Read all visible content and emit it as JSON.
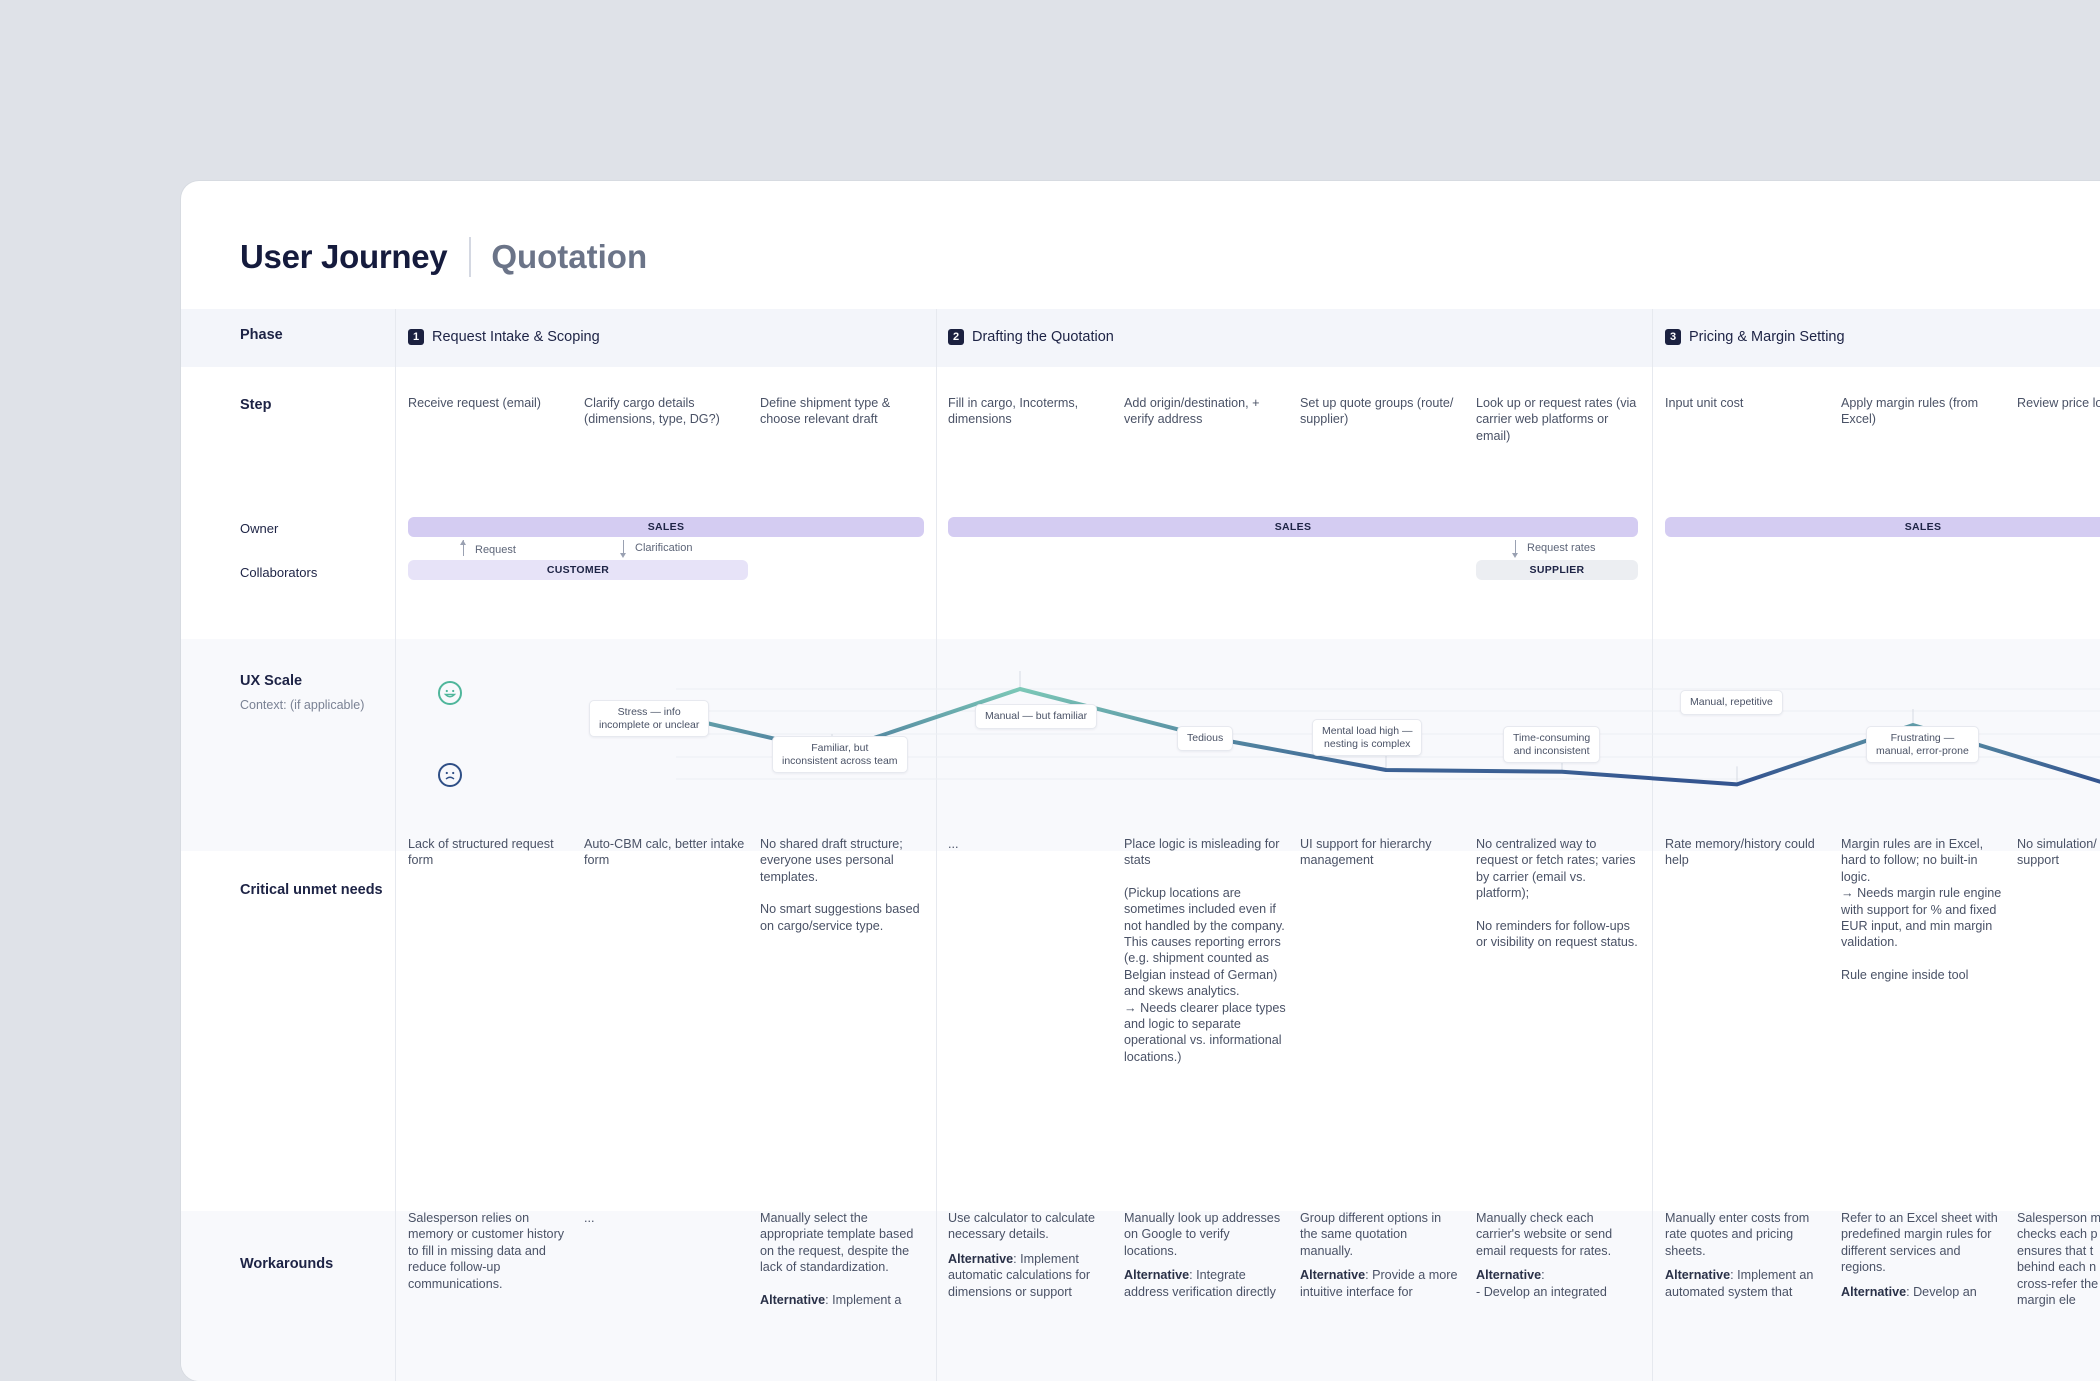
{
  "header": {
    "title": "User Journey",
    "subtitle": "Quotation"
  },
  "labels": {
    "phase": "Phase",
    "step": "Step",
    "owner": "Owner",
    "collaborators": "Collaborators",
    "ux_scale": "UX Scale",
    "context": "Context: (if applicable)",
    "needs": "Critical unmet needs",
    "workarounds": "Workarounds"
  },
  "phases": [
    {
      "num": "1",
      "label": "Request Intake & Scoping"
    },
    {
      "num": "2",
      "label": "Drafting the Quotation"
    },
    {
      "num": "3",
      "label": "Pricing & Margin Setting"
    }
  ],
  "steps": [
    "Receive request (email)",
    "Clarify cargo details (dimensions, type, DG?)",
    "Define shipment type & choose relevant draft",
    "Fill in cargo, Incoterms, dimensions",
    "Add origin/destination, + verify address",
    "Set up quote groups (route/ supplier)",
    "Look up or request rates (via carrier web platforms or email)",
    "Input unit cost",
    "Apply margin rules (from Excel)",
    "Review price lo"
  ],
  "owners": {
    "sales": "SALES",
    "customer": "CUSTOMER",
    "supplier": "SUPPLIER"
  },
  "flows": {
    "request": "Request",
    "clarification": "Clarification",
    "request_rates": "Request rates"
  },
  "ux": {
    "icons": {
      "happy": "happy-face-icon",
      "sad": "sad-face-icon"
    },
    "colors": {
      "positive": "#7cc8b7",
      "negative": "#355690"
    },
    "points": [
      0.7,
      0.3,
      1.0,
      0.46,
      0.1,
      0.08,
      -0.06,
      0.6,
      -0.05
    ],
    "tag1a": "Stress — info",
    "tag1b": "incomplete or unclear",
    "tag2a": "Familiar, but",
    "tag2b": "inconsistent across team",
    "tag3": "Manual — but familiar",
    "tag4": "Tedious",
    "tag5a": "Mental load high —",
    "tag5b": "nesting is complex",
    "tag6a": "Time-consuming",
    "tag6b": "and inconsistent",
    "tag7": "Manual, repetitive",
    "tag8a": "Frustrating —",
    "tag8b": "manual, error-prone"
  },
  "needs": {
    "c1": "Lack of structured request form",
    "c2": "Auto-CBM calc, better intake form",
    "c3a": "No shared draft structure; everyone uses personal templates.",
    "c3b": "No smart suggestions based on cargo/service type.",
    "c4": "...",
    "c5a": "Place logic is misleading for stats",
    "c5b": "(Pickup locations are sometimes included even if not handled by the company. This causes reporting errors (e.g. shipment counted as Belgian instead of German) and skews analytics.",
    "c5c": "→ Needs clearer place types and logic to separate operational vs. informational locations.)",
    "c6": "UI support for hierarchy management",
    "c7a": "No centralized way to request or fetch rates; varies by carrier (email vs. platform);",
    "c7b": "No reminders for follow-ups or visibility on request status.",
    "c8": "Rate memory/history could help",
    "c9a": "Margin rules are in Excel, hard to follow; no built-in logic.",
    "c9b": "→ Needs margin rule engine with support for % and fixed EUR input, and min margin validation.",
    "c9c": "Rule engine inside tool",
    "c10": "No simulation/ support"
  },
  "workarounds": {
    "c1": "Salesperson relies on memory or customer history to fill in missing data and reduce follow-up communications.",
    "c2": "...",
    "c3a": "Manually select the appropriate template based on the request, despite the lack of standardization.",
    "c3b_label": "Alternative",
    "c3b": ": Implement a",
    "c4a": "Use calculator to calculate necessary details.",
    "c4b_label": "Alternative",
    "c4b": ": Implement automatic calculations for dimensions or support",
    "c5a": "Manually look up addresses on Google to verify locations.",
    "c5b_label": "Alternative",
    "c5b": ": Integrate address verification directly",
    "c6a": "Group different options in the same quotation manually.",
    "c6b_label": "Alternative",
    "c6b": ": Provide a more intuitive interface for",
    "c7a": "Manually check each carrier's website or send email requests for rates.",
    "c7b_label": "Alternative",
    "c7b": ":",
    "c7c": "- Develop an integrated",
    "c8a": "Manually enter costs from rate quotes and pricing sheets.",
    "c8b_label": "Alternative",
    "c8b": ": Implement an automated system that",
    "c9a": "Refer to an Excel sheet with predefined margin rules for different services and regions.",
    "c9b_label": "Alternative",
    "c9b": ": Develop an",
    "c10": "Salesperson m checks each p ensures that t behind each n by cross-refer the margin ele"
  }
}
